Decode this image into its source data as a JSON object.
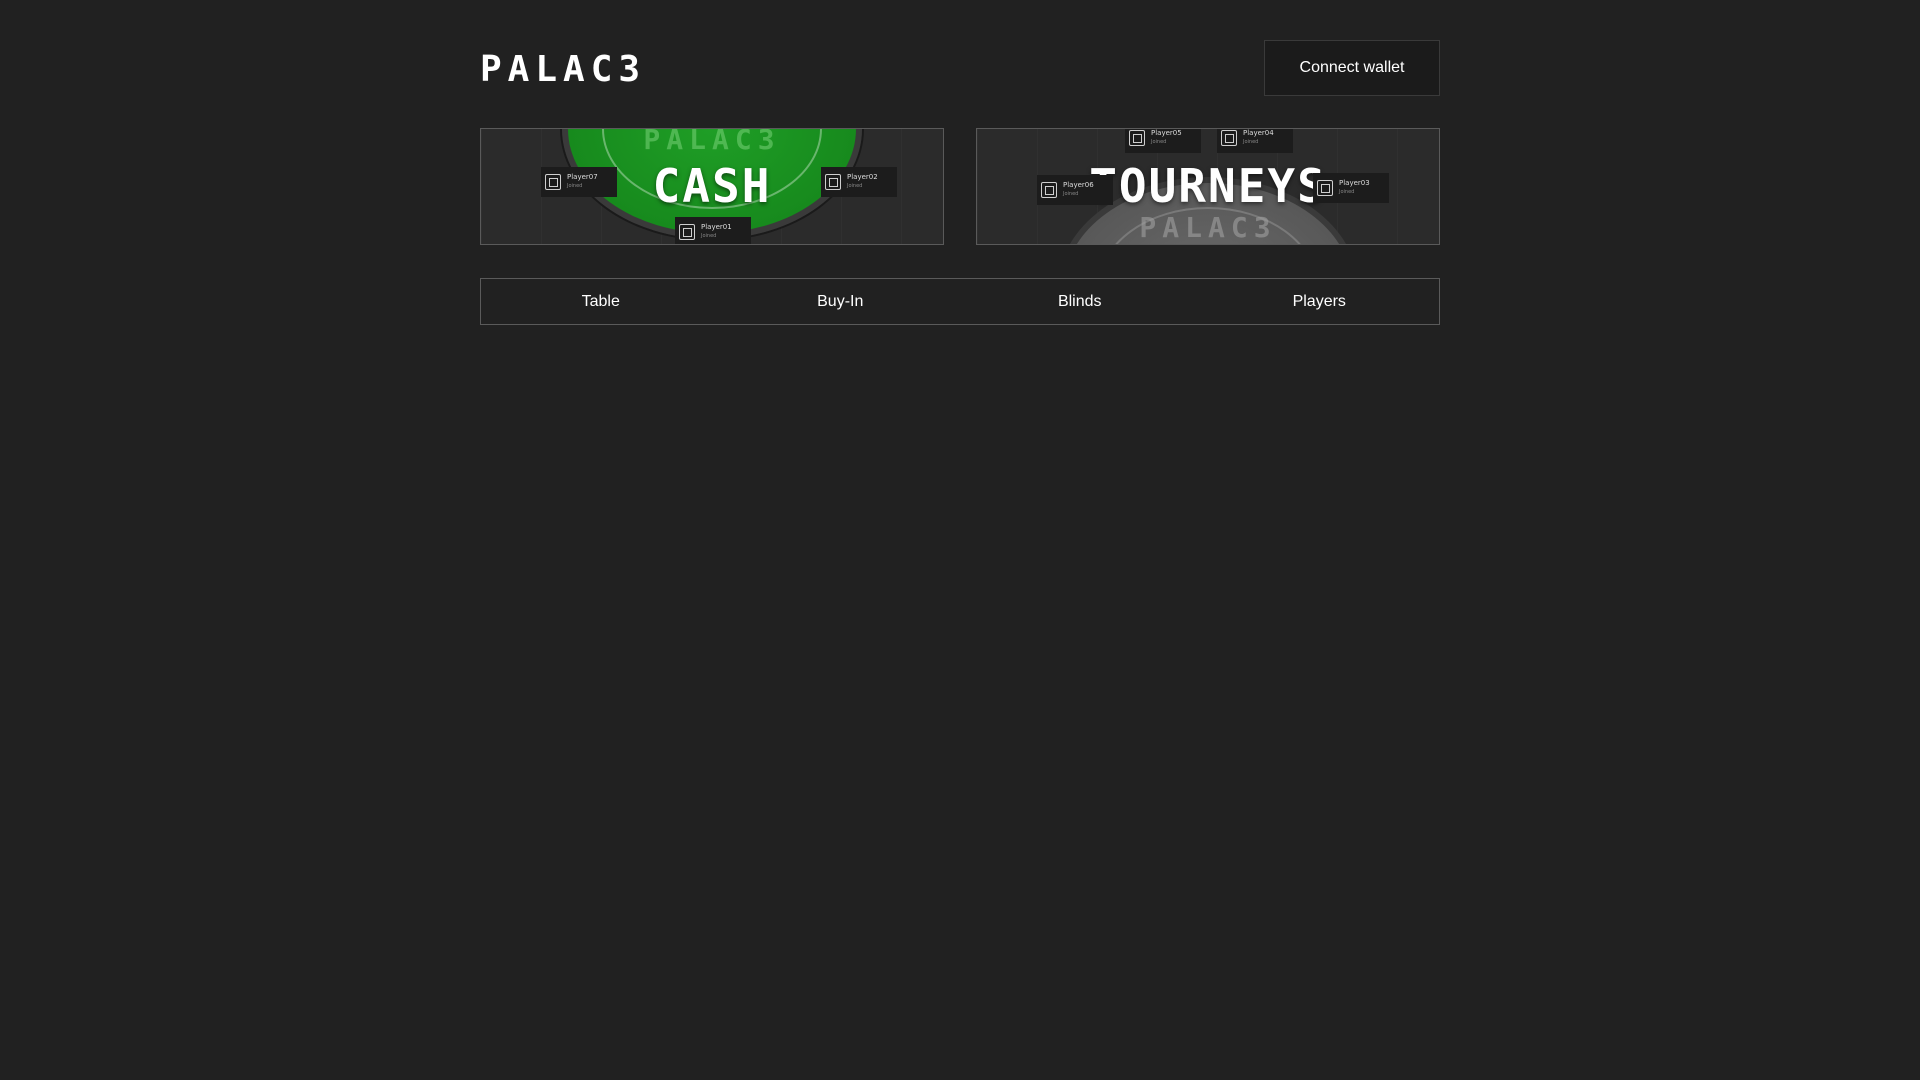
{
  "header": {
    "logo_text": "PALAC3",
    "connect_label": "Connect wallet"
  },
  "banners": {
    "cash": {
      "title": "CASH",
      "watermark": "PALAC3",
      "seats": [
        {
          "name": "Player07",
          "status": "Joined"
        },
        {
          "name": "Player02",
          "status": "Joined"
        },
        {
          "name": "Player01",
          "status": "Joined"
        }
      ]
    },
    "tourneys": {
      "title": "TOURNEYS",
      "watermark": "PALAC3",
      "seats": [
        {
          "name": "Player05",
          "status": "Joined"
        },
        {
          "name": "Player04",
          "status": "Joined"
        },
        {
          "name": "Player06",
          "status": "Joined"
        },
        {
          "name": "Player03",
          "status": "Joined"
        }
      ]
    }
  },
  "filters": {
    "columns": [
      "Table",
      "Buy-In",
      "Blinds",
      "Players"
    ]
  },
  "colors": {
    "background": "#212121",
    "cash_felt": "#1f9e26",
    "tourney_felt": "#6a6a6a"
  }
}
